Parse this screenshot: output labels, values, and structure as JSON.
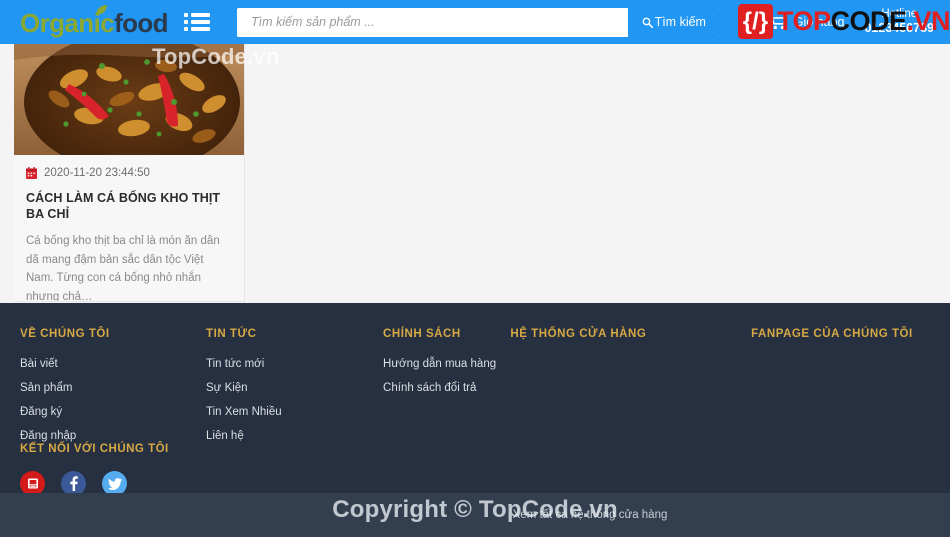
{
  "header": {
    "logo": {
      "part1": "Organic",
      "part2": "food",
      "leaf_icon": "leaf-icon",
      "color_green": "#8aa832",
      "color_navy": "#2b3a4d"
    },
    "menu_icon": "list-menu-icon",
    "search": {
      "placeholder": "Tìm kiếm sản phẩm ...",
      "value": "",
      "button_label": "Tìm kiếm",
      "button_icon": "search-icon"
    },
    "cart": {
      "icon": "shopping-cart-icon",
      "label": "Giỏ hàng"
    },
    "hotline": {
      "label": "Hotline",
      "number": "0123456789"
    },
    "background_color": "#2196f3"
  },
  "main": {
    "article": {
      "image_alt": "ca-bong-kho-thit-ba-chi-photo",
      "date_icon": "calendar-icon",
      "date": "2020-11-20 23:44:50",
      "title": "CÁCH LÀM CÁ BỐNG KHO THỊT BA CHỈ",
      "excerpt": "Cá bống kho thịt ba chỉ là món ăn dân dã mang đậm bản sắc dân tộc Việt Nam. Từng con cá bống nhỏ nhắn nhưng chả…"
    }
  },
  "footer": {
    "background_color": "#263040",
    "heading_color": "#d6a944",
    "columns": [
      {
        "heading": "VỀ CHÚNG TÔI",
        "links": [
          "Bài viết",
          "Sản phẩm",
          "Đăng ký",
          "Đăng nhập"
        ]
      },
      {
        "heading": "TIN TỨC",
        "links": [
          "Tin tức mới",
          "Sự Kiện",
          "Tin Xem Nhiều",
          "Liên hệ"
        ]
      },
      {
        "heading": "CHÍNH SÁCH",
        "links": [
          "Hướng dẫn mua hàng",
          "Chính sách đổi trả"
        ]
      },
      {
        "heading": "HỆ THỐNG CỬA HÀNG",
        "links": []
      },
      {
        "heading": "FANPAGE CỦA CHÚNG TÔI",
        "links": []
      }
    ],
    "connect": {
      "heading": "KẾT NỐI VỚI CHÚNG TÔI",
      "socials": [
        {
          "name": "youtube-icon",
          "color": "#d31b1b"
        },
        {
          "name": "facebook-icon",
          "color": "#3b5998"
        },
        {
          "name": "twitter-icon",
          "color": "#55acee"
        }
      ]
    }
  },
  "bottom_bar": {
    "background_color": "#333f4f",
    "store_link": "Xem tất cả hệ thống cửa hàng"
  },
  "watermarks": {
    "top_text": "TopCode.vn",
    "logo_brace": "{/}",
    "logo_top": "TOP",
    "logo_code": "CODE",
    "logo_vn": ".VN",
    "copyright": "Copyright © TopCode.vn"
  }
}
